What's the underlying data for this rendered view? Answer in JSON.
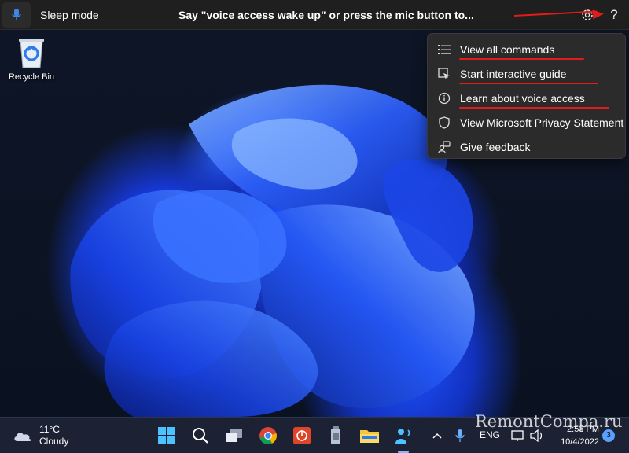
{
  "voice_bar": {
    "status": "Sleep mode",
    "hint": "Say \"voice access wake up\" or press the mic button to...",
    "settings_icon": "gear-icon",
    "help_label": "?"
  },
  "help_menu": {
    "items": [
      {
        "label": "View all commands",
        "icon": "list-icon",
        "underlined": true
      },
      {
        "label": "Start interactive guide",
        "icon": "guide-icon",
        "underlined": true
      },
      {
        "label": "Learn about voice access",
        "icon": "info-icon",
        "underlined": true
      },
      {
        "label": "View Microsoft Privacy Statement",
        "icon": "shield-icon",
        "underlined": false
      },
      {
        "label": "Give feedback",
        "icon": "feedback-icon",
        "underlined": false
      }
    ]
  },
  "desktop": {
    "recycle_bin_label": "Recycle Bin"
  },
  "taskbar": {
    "weather": {
      "temp": "11°C",
      "condition": "Cloudy"
    },
    "apps": [
      "windows-start-icon",
      "search-icon",
      "task-view-icon",
      "chrome-icon",
      "app-icon",
      "recycle-app-icon",
      "file-explorer-icon",
      "voice-access-icon"
    ],
    "language": "ENG",
    "time": "2:53 PM",
    "date": "10/4/2022",
    "notification_count": "3"
  },
  "annotation": {
    "color": "#e31b1b"
  },
  "watermark": "RemontCompa.ru"
}
